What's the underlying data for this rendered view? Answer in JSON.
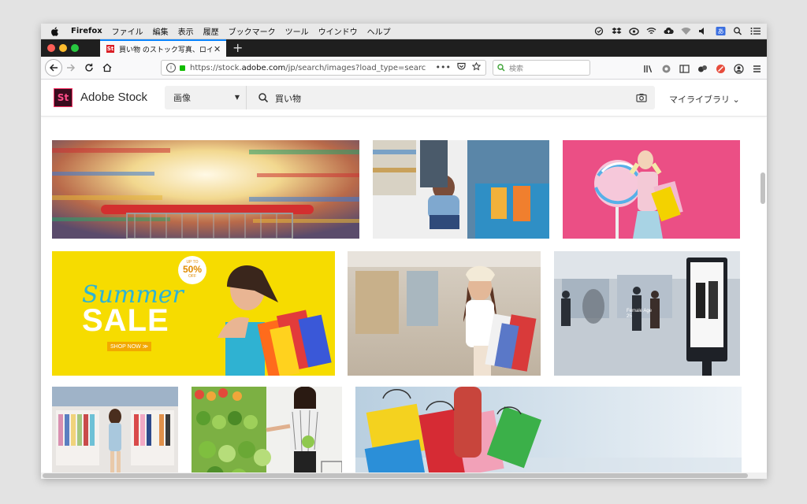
{
  "menubar": {
    "app_name": "Firefox",
    "items": [
      "ファイル",
      "編集",
      "表示",
      "履歴",
      "ブックマーク",
      "ツール",
      "ウインドウ",
      "ヘルプ"
    ]
  },
  "tab": {
    "title": "買い物 のストック写真、ロイヤ..."
  },
  "navbar": {
    "url_prefix": "https://stock.",
    "url_domain": "adobe.com",
    "url_rest": "/jp/search/images?load_type=search&n",
    "url_more": "•••",
    "search_placeholder": "検索"
  },
  "header": {
    "logo_text": "St",
    "brand": "Adobe Stock",
    "type_select": "画像",
    "query": "買い物",
    "library_menu": "マイライブラリ ⌄"
  },
  "tiles": [
    {
      "name": "supermarket-cart-motion",
      "colors": [
        "#d8453a",
        "#e9d9a4"
      ]
    },
    {
      "name": "kids-shopping-aisle",
      "colors": [
        "#4a7cb0",
        "#eeeeee"
      ]
    },
    {
      "name": "woman-lollipop-pink",
      "colors": [
        "#e8437e",
        "#f3a7c4"
      ]
    },
    {
      "name": "summer-sale-banner",
      "colors": [
        "#f5dc00",
        "#22b3d6"
      ],
      "script": "Summer",
      "sale": "SALE",
      "badge_top": "UP TO",
      "badge_pct": "50%",
      "badge_off": "OFF",
      "cta": "SHOP NOW ≫"
    },
    {
      "name": "woman-mall-bags",
      "colors": [
        "#c9b59b",
        "#e34d3d"
      ]
    },
    {
      "name": "mall-digital-sign",
      "colors": [
        "#b9c2cb",
        "#2b2f36"
      ],
      "sign_text": "Female Age 25"
    },
    {
      "name": "clothing-store-woman",
      "colors": [
        "#7f9ec2",
        "#e9e4df"
      ]
    },
    {
      "name": "woman-produce-aisle",
      "colors": [
        "#6eaa3a",
        "#eeeeee"
      ]
    },
    {
      "name": "colorful-shopping-bags",
      "colors": [
        "#b6c9da",
        "#e72c4f"
      ]
    }
  ]
}
